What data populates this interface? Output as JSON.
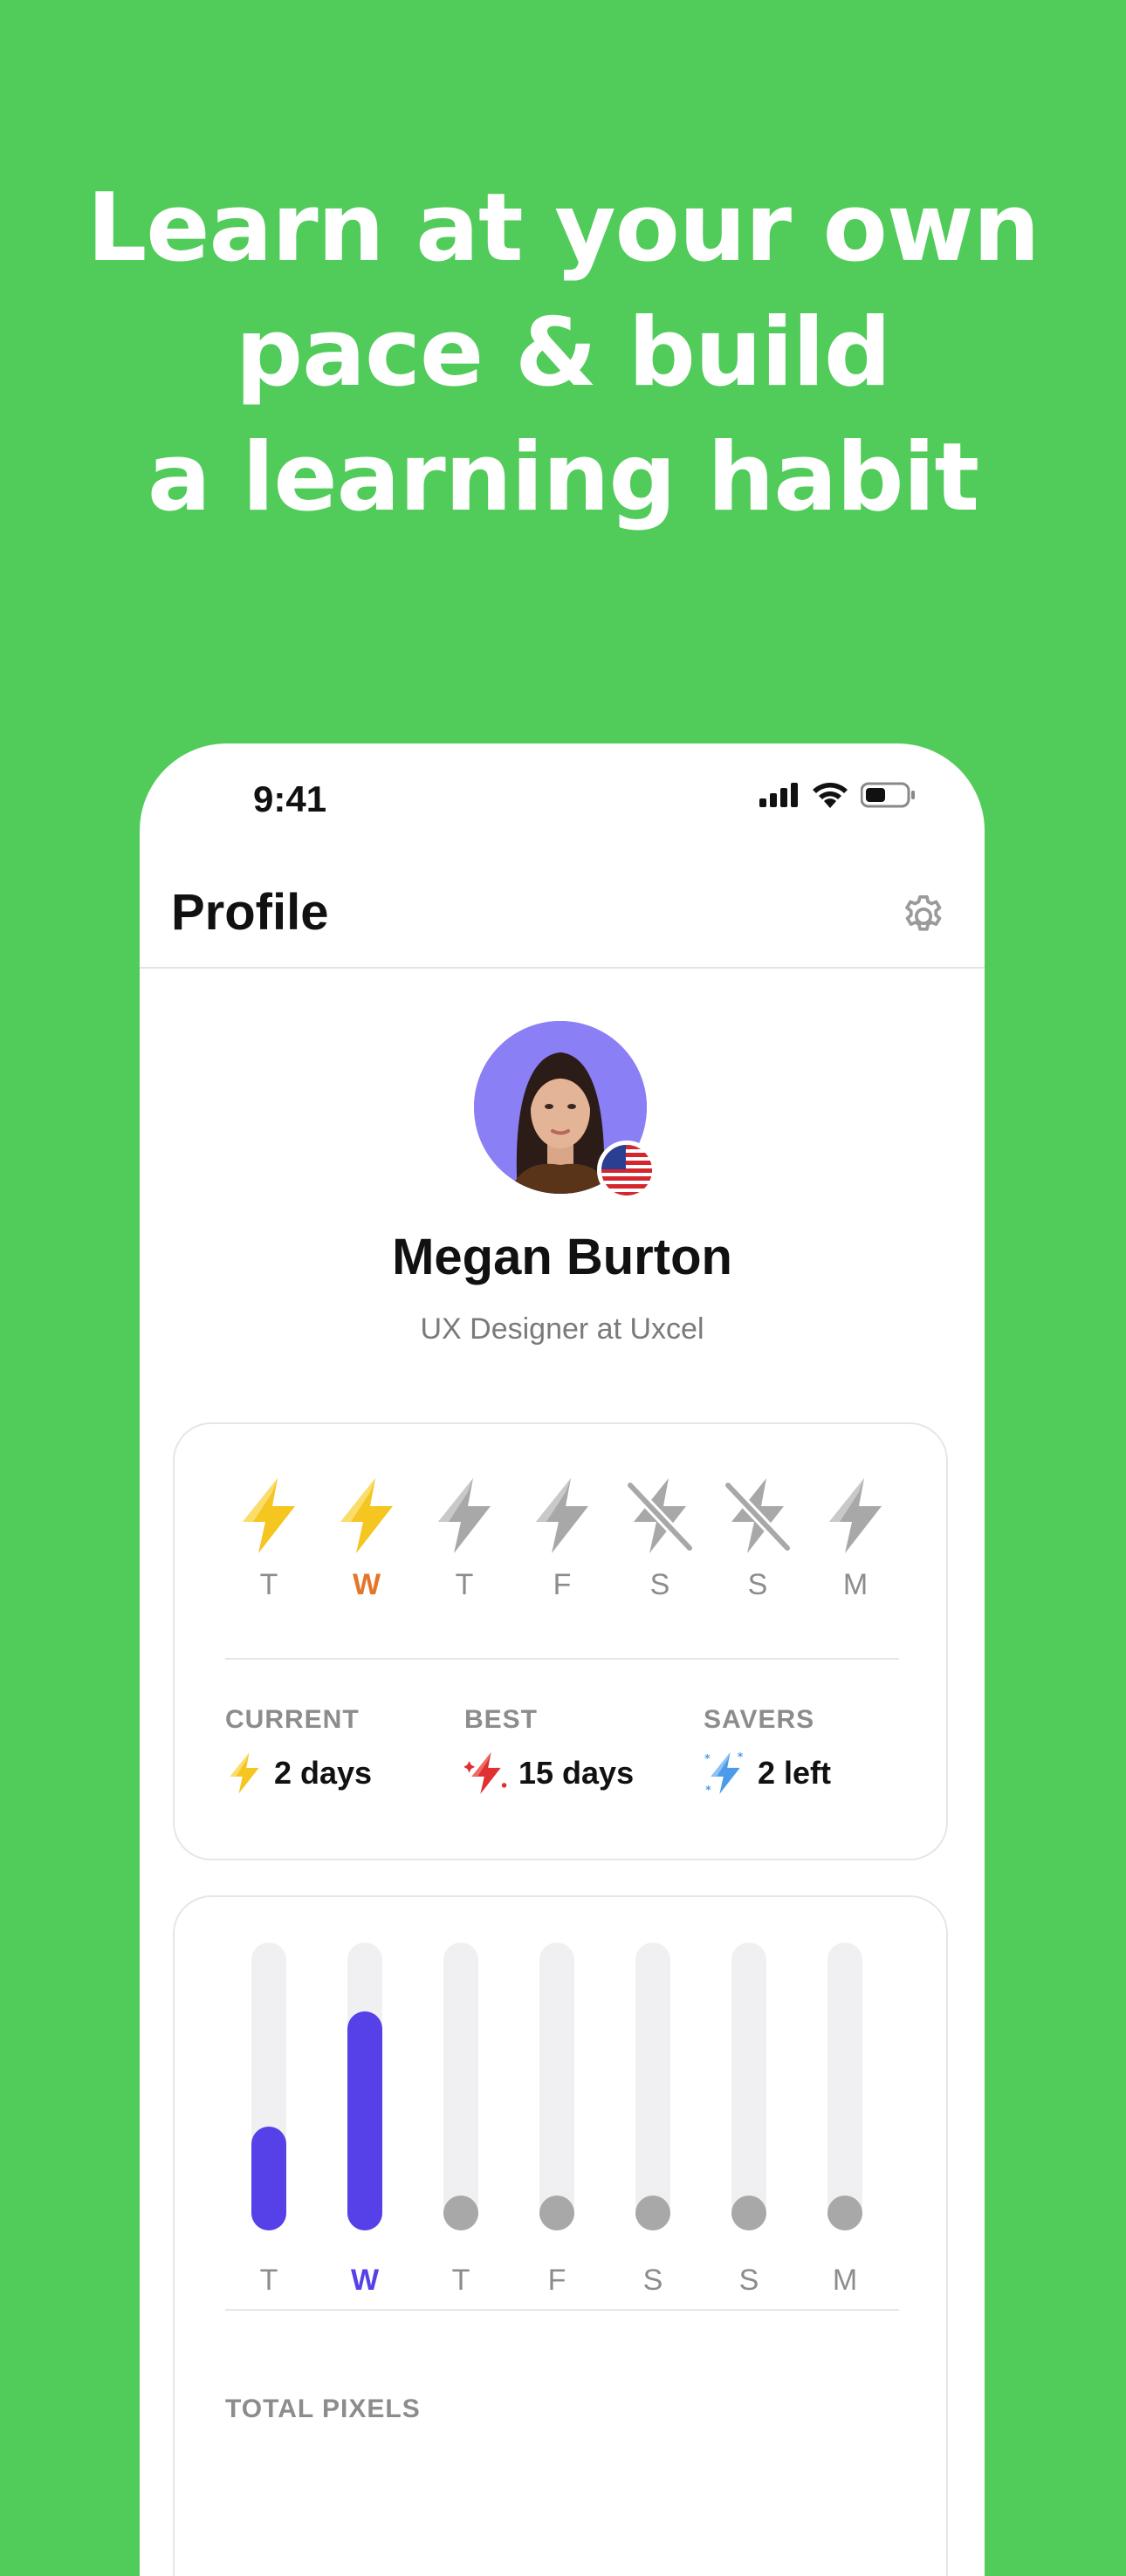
{
  "headline": [
    "Learn at your own",
    "pace & build",
    "a learning habit"
  ],
  "status_bar": {
    "time": "9:41"
  },
  "nav": {
    "title": "Profile"
  },
  "profile": {
    "name": "Megan Burton",
    "subtitle": "UX Designer at Uxcel",
    "flag": "us-flag-icon"
  },
  "streak": {
    "days": [
      {
        "label": "T",
        "state": "done"
      },
      {
        "label": "W",
        "state": "done",
        "today": true
      },
      {
        "label": "T",
        "state": "empty"
      },
      {
        "label": "F",
        "state": "empty"
      },
      {
        "label": "S",
        "state": "off"
      },
      {
        "label": "S",
        "state": "off"
      },
      {
        "label": "M",
        "state": "empty"
      }
    ],
    "stats": [
      {
        "label": "CURRENT",
        "value": "2 days",
        "icon": "bolt-yellow-icon"
      },
      {
        "label": "BEST",
        "value": "15 days",
        "icon": "bolt-red-icon"
      },
      {
        "label": "SAVERS",
        "value": "2 left",
        "icon": "bolt-frozen-icon"
      }
    ]
  },
  "pixels": {
    "days": [
      "T",
      "W",
      "T",
      "F",
      "S",
      "S",
      "M"
    ],
    "today_index": 1,
    "levels": [
      0.36,
      0.76,
      0,
      0,
      0,
      0,
      0
    ],
    "total_label": "TOTAL PIXELS"
  },
  "colors": {
    "background": "#51CB5A",
    "accent": "#5541E7",
    "streak": "#F5C520",
    "today_streak": "#E3762B"
  }
}
